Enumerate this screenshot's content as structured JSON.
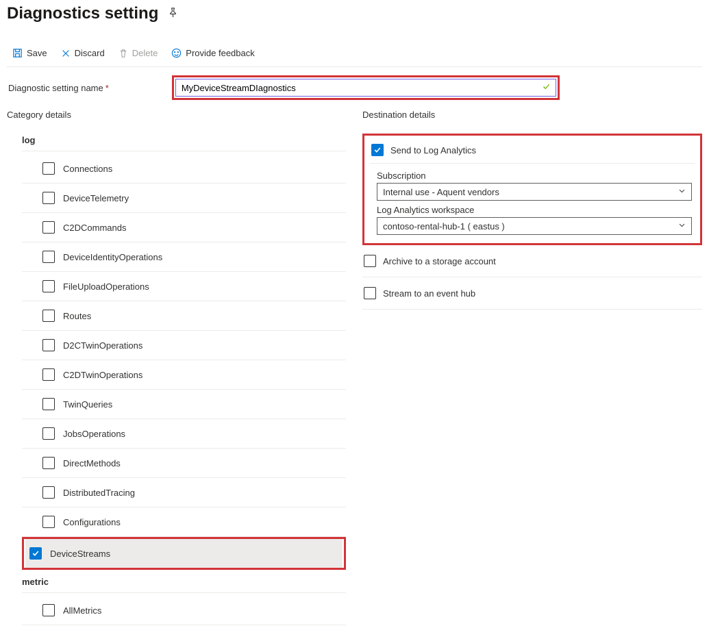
{
  "header": {
    "title": "Diagnostics setting"
  },
  "toolbar": {
    "save": "Save",
    "discard": "Discard",
    "delete": "Delete",
    "feedback": "Provide feedback"
  },
  "form": {
    "name_label": "Diagnostic setting name",
    "name_value": "MyDeviceStreamDIagnostics"
  },
  "categories": {
    "heading": "Category details",
    "log_group": "log",
    "metric_group": "metric",
    "logs": [
      {
        "label": "Connections",
        "checked": false
      },
      {
        "label": "DeviceTelemetry",
        "checked": false
      },
      {
        "label": "C2DCommands",
        "checked": false
      },
      {
        "label": "DeviceIdentityOperations",
        "checked": false
      },
      {
        "label": "FileUploadOperations",
        "checked": false
      },
      {
        "label": "Routes",
        "checked": false
      },
      {
        "label": "D2CTwinOperations",
        "checked": false
      },
      {
        "label": "C2DTwinOperations",
        "checked": false
      },
      {
        "label": "TwinQueries",
        "checked": false
      },
      {
        "label": "JobsOperations",
        "checked": false
      },
      {
        "label": "DirectMethods",
        "checked": false
      },
      {
        "label": "DistributedTracing",
        "checked": false
      },
      {
        "label": "Configurations",
        "checked": false
      },
      {
        "label": "DeviceStreams",
        "checked": true
      }
    ],
    "metrics": [
      {
        "label": "AllMetrics",
        "checked": false
      }
    ]
  },
  "destinations": {
    "heading": "Destination details",
    "log_analytics": {
      "label": "Send to Log Analytics",
      "checked": true,
      "subscription_label": "Subscription",
      "subscription_value": "Internal use - Aquent vendors",
      "workspace_label": "Log Analytics workspace",
      "workspace_value": "contoso-rental-hub-1 ( eastus )"
    },
    "storage": {
      "label": "Archive to a storage account",
      "checked": false
    },
    "eventhub": {
      "label": "Stream to an event hub",
      "checked": false
    }
  }
}
